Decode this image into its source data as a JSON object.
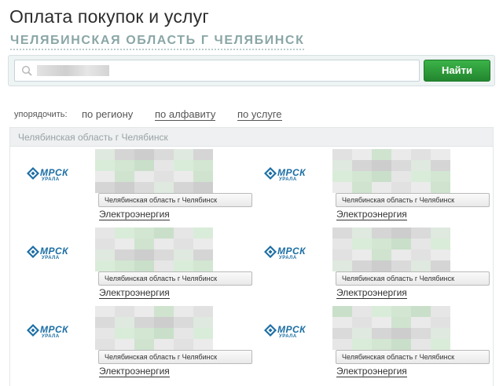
{
  "header": {
    "title": "Оплата покупок и услуг",
    "region": "ЧЕЛЯБИНСКАЯ ОБЛАСТЬ Г ЧЕЛЯБИНСК"
  },
  "search": {
    "value": "",
    "placeholder": "",
    "button_label": "Найти"
  },
  "sort": {
    "label": "упорядочить:",
    "options": [
      {
        "label": "по региону",
        "active": true
      },
      {
        "label": "по алфавиту",
        "active": false
      },
      {
        "label": "по услуге",
        "active": false
      }
    ]
  },
  "results": {
    "group_title": "Челябинская область г Челябинск",
    "cards": [
      {
        "logo_main": "МРСК",
        "logo_sub": "УРАЛА",
        "region": "Челябинская область г Челябинск",
        "category": "Электроэнергия"
      },
      {
        "logo_main": "МРСК",
        "logo_sub": "УРАЛА",
        "region": "Челябинская область г Челябинск",
        "category": "Электроэнергия"
      },
      {
        "logo_main": "МРСК",
        "logo_sub": "УРАЛА",
        "region": "Челябинская область г Челябинск",
        "category": "Электроэнергия"
      },
      {
        "logo_main": "МРСК",
        "logo_sub": "УРАЛА",
        "region": "Челябинская область г Челябинск",
        "category": "Электроэнергия"
      },
      {
        "logo_main": "МРСК",
        "logo_sub": "УРАЛА",
        "region": "Челябинская область г Челябинск",
        "category": "Электроэнергия"
      },
      {
        "logo_main": "МРСК",
        "logo_sub": "УРАЛА",
        "region": "Челябинская область г Челябинск",
        "category": "Электроэнергия"
      }
    ]
  },
  "colors": {
    "accent_green": "#2f9e3a",
    "logo_blue": "#1c6ea4",
    "region_teal": "#8aa6a6"
  },
  "icons": {
    "search": "search-icon",
    "logo": "mrsk-logo-icon"
  }
}
